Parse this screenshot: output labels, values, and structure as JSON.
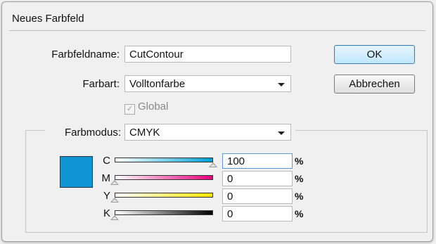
{
  "dialog": {
    "title": "Neues Farbfeld",
    "swatch_name_label": "Farbfeldname:",
    "swatch_name_value": "CutContour",
    "color_type_label": "Farbart:",
    "color_type_value": "Volltonfarbe",
    "global_label": "Global",
    "global_checked": true,
    "global_enabled": false,
    "color_mode_label": "Farbmodus:",
    "color_mode_value": "CMYK",
    "ok_label": "OK",
    "cancel_label": "Abbrechen",
    "swatch_color": "#0f95d6",
    "channels": [
      {
        "letter": "C",
        "value": "100",
        "unit": "%",
        "level": 1.0,
        "gradient_end": "#00a0d6"
      },
      {
        "letter": "M",
        "value": "0",
        "unit": "%",
        "level": 0.0,
        "gradient_end": "#e6007e"
      },
      {
        "letter": "Y",
        "value": "0",
        "unit": "%",
        "level": 0.0,
        "gradient_end": "#ffe600"
      },
      {
        "letter": "K",
        "value": "0",
        "unit": "%",
        "level": 0.0,
        "gradient_end": "#000000"
      }
    ]
  }
}
